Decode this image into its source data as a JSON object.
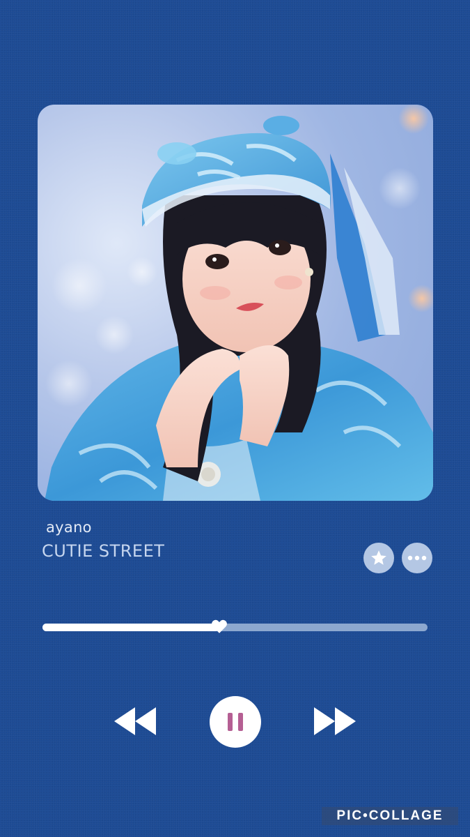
{
  "track": {
    "artist": "ayano",
    "title": "CUTIE STREET"
  },
  "cover": {
    "icon": "album-cover-photo"
  },
  "actions": {
    "favorite_icon": "star-icon",
    "more_icon": "ellipsis-icon"
  },
  "playback": {
    "progress_fraction": 0.46,
    "state": "playing",
    "rewind_icon": "rewind-icon",
    "pause_icon": "pause-icon",
    "forward_icon": "fast-forward-icon"
  },
  "watermark": {
    "text": "PIC•COLLAGE"
  },
  "colors": {
    "background": "#1d4b94",
    "track_remaining": "#8da8cf",
    "track_played": "#ffffff",
    "pause_bars": "#b55f93",
    "action_buttons": "#b4c7e4"
  }
}
